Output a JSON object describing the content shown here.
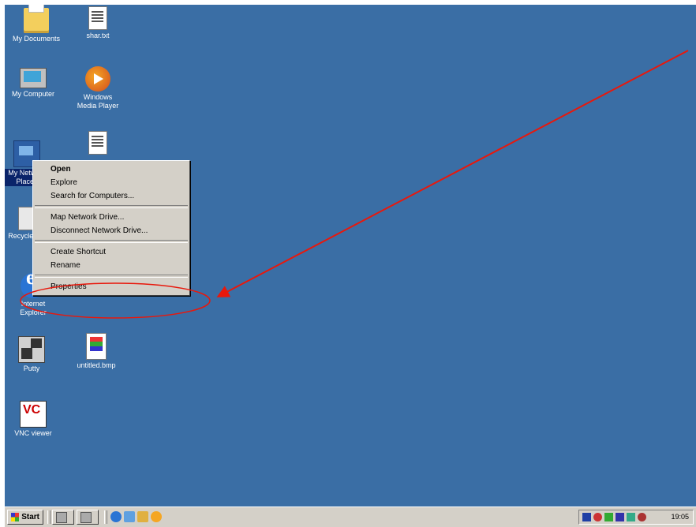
{
  "desktop": {
    "background_color": "#3a6ea5",
    "icons": [
      {
        "label": "My Documents",
        "icon": "folder-icon"
      },
      {
        "label": "shar.txt",
        "icon": "text-file-icon"
      },
      {
        "label": "My Computer",
        "icon": "computer-icon"
      },
      {
        "label": "Windows Media Player",
        "icon": "media-player-icon"
      },
      {
        "label": "My Network Places",
        "icon": "network-icon"
      },
      {
        "label": "Recycle Bin",
        "icon": "recycle-bin-icon"
      },
      {
        "label": "Internet Explorer",
        "icon": "internet-explorer-icon"
      },
      {
        "label": "Putty",
        "icon": "putty-icon"
      },
      {
        "label": "untitled.bmp",
        "icon": "bitmap-file-icon"
      },
      {
        "label": "VNC viewer",
        "icon": "vnc-icon"
      }
    ]
  },
  "context_menu": {
    "items": [
      {
        "label": "Open",
        "bold": true
      },
      {
        "label": "Explore"
      },
      {
        "label": "Search for Computers..."
      },
      {
        "label": "Map Network Drive..."
      },
      {
        "label": "Disconnect Network Drive..."
      },
      {
        "label": "Create Shortcut"
      },
      {
        "label": "Rename"
      },
      {
        "label": "Properties"
      }
    ]
  },
  "annotation": {
    "color": "#e8180c"
  },
  "taskbar": {
    "start_label": "Start",
    "clock": "19:05"
  }
}
